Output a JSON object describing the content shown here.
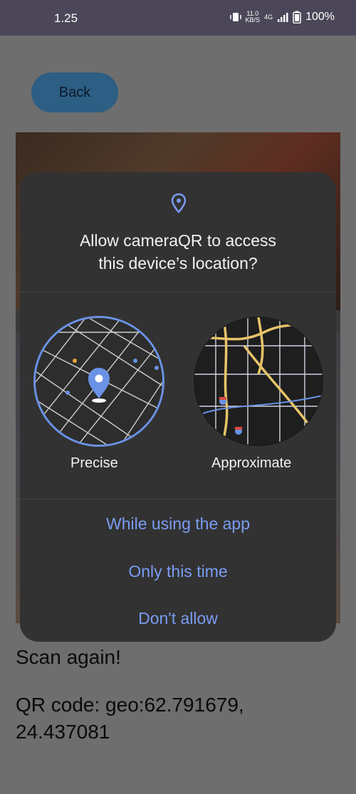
{
  "status_bar": {
    "time": "1.25",
    "net_speed_value": "11.0",
    "net_speed_unit": "KB/S",
    "network_type": "4G",
    "battery": "100%"
  },
  "app": {
    "back_label": "Back",
    "scan_again": "Scan again!",
    "qr_line1": "QR code: geo:62.791679,",
    "qr_line2": "24.437081"
  },
  "dialog": {
    "title_line1": "Allow cameraQR to access",
    "title_line2": "this device’s location?",
    "precise_label": "Precise",
    "approximate_label": "Approximate",
    "actions": [
      "While using the app",
      "Only this time",
      "Don't allow"
    ],
    "accent_color": "#7a9cf2",
    "precise_selected": true
  },
  "icons": {
    "location": "location-pin-icon",
    "vibrate": "vibrate-icon",
    "signal": "signal-icon",
    "battery": "battery-icon"
  }
}
